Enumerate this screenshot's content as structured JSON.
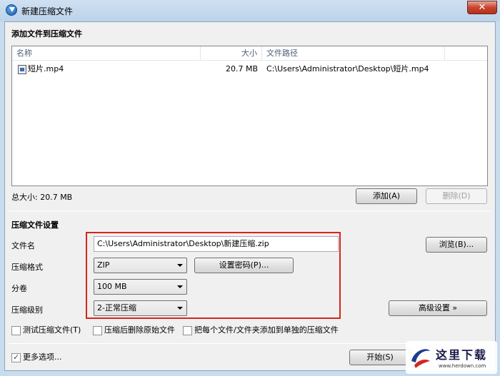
{
  "window": {
    "title": "新建压缩文件",
    "close_symbol": "✕"
  },
  "add_section": {
    "title": "添加文件到压缩文件",
    "columns": [
      "名称",
      "大小",
      "文件路径"
    ],
    "files": [
      {
        "name": "短片.mp4",
        "size": "20.7 MB",
        "path": "C:\\Users\\Administrator\\Desktop\\短片.mp4",
        "icon": "video-file-icon"
      }
    ],
    "total_size": "总大小: 20.7 MB",
    "add_button": "添加(A)",
    "delete_button": "删除(D)"
  },
  "settings": {
    "title": "压缩文件设置",
    "filename_label": "文件名",
    "filename_value": "C:\\Users\\Administrator\\Desktop\\新建压缩.zip",
    "browse_button": "浏览(B)...",
    "format_label": "压缩格式",
    "format_value": "ZIP",
    "password_button": "设置密码(P)...",
    "volume_label": "分卷",
    "volume_value": "100 MB",
    "level_label": "压缩级别",
    "level_value": "2-正常压缩",
    "advanced_button": "高级设置 »",
    "options": [
      {
        "label": "测试压缩文件(T)",
        "checked": false
      },
      {
        "label": "压缩后删除原始文件",
        "checked": false
      },
      {
        "label": "把每个文件/文件夹添加到单独的压缩文件",
        "checked": false
      }
    ]
  },
  "footer": {
    "more_options": "更多选项...",
    "more_options_checked": true,
    "start_button": "开始(S)"
  },
  "watermark": {
    "text": "这里下载",
    "url": "www.herdown.com"
  },
  "colors": {
    "highlight": "#d6251d",
    "titlebar": "#bcd3ea",
    "client_bg": "#f0f0f0"
  }
}
